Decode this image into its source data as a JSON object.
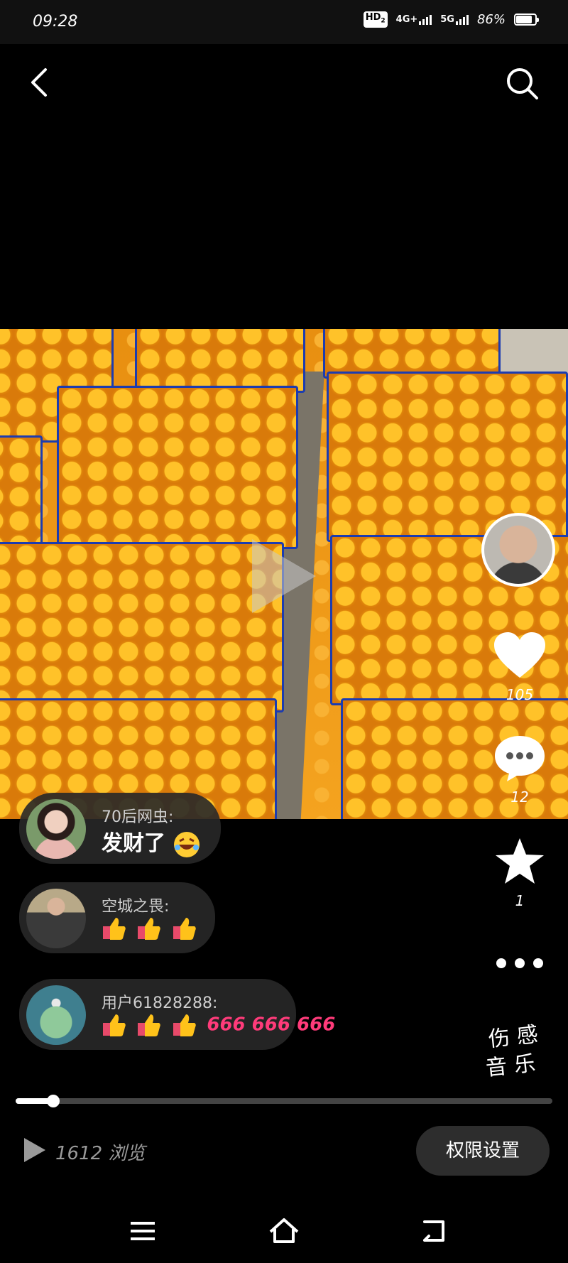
{
  "status_bar": {
    "time": "09:28",
    "hd_badge": "HD",
    "sim_indicator": "2",
    "network_1": "4G+",
    "network_2": "5G",
    "battery": "86%"
  },
  "header": {
    "back_icon": "chevron-left-icon",
    "search_icon": "search-icon"
  },
  "video": {
    "play_icon": "play-icon"
  },
  "sidebar": {
    "like_count": "105",
    "comment_count": "12",
    "favorite_count": "1",
    "music_label_line1": "伤感",
    "music_label_line2": "音乐"
  },
  "comments": [
    {
      "name": "70后网虫:",
      "text": "发财了",
      "emoji": "laughing-tears-emoji"
    },
    {
      "name": "空城之畏:",
      "text": "",
      "emoji": "thumbs-up x3"
    },
    {
      "name": "用户61828288:",
      "text": "666 666 666",
      "emoji": "thumbs-up x3"
    }
  ],
  "playback": {
    "progress_fraction": 0.07,
    "views": "1612 浏览",
    "permission_button": "权限设置"
  },
  "colors": {
    "background": "#000000",
    "accent_666": "#ff3b7a"
  }
}
